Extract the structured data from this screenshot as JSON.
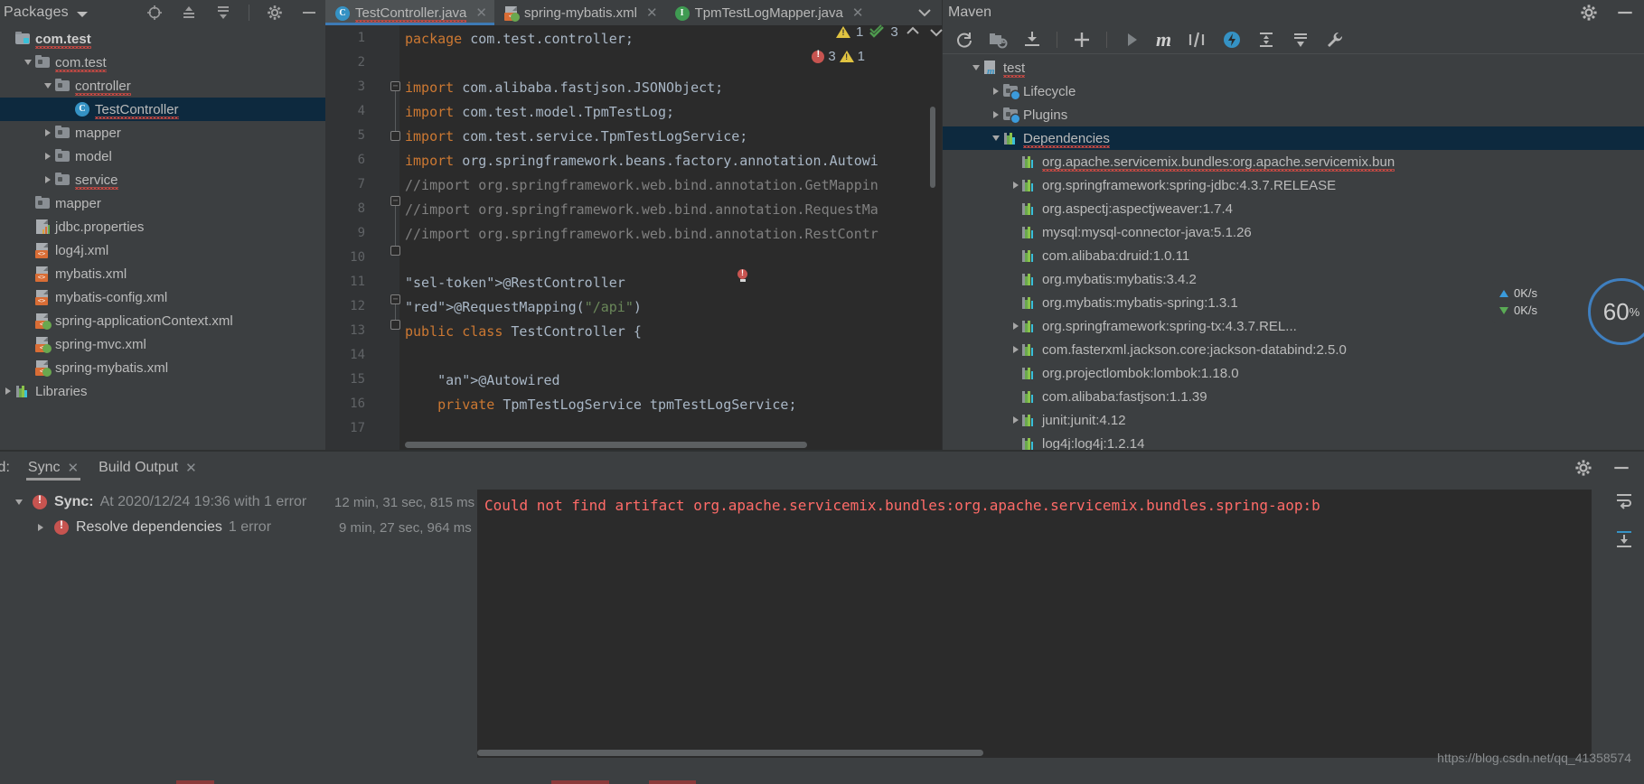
{
  "project_panel": {
    "title": "Packages",
    "toolbar_icons": [
      "locate-icon",
      "expand-all-icon",
      "collapse-all-icon",
      "settings-gear-icon",
      "hide-panel-icon"
    ],
    "tree": [
      {
        "label": "com.test",
        "icon": "package-root-icon",
        "indent": 0,
        "twisty": "none",
        "bold": true,
        "squiggle": true,
        "selected": false
      },
      {
        "label": "com.test",
        "icon": "folder-icon",
        "indent": 1,
        "twisty": "open",
        "bold": false,
        "squiggle": true,
        "selected": false
      },
      {
        "label": "controller",
        "icon": "folder-icon",
        "indent": 2,
        "twisty": "open",
        "bold": false,
        "squiggle": true,
        "selected": false
      },
      {
        "label": "TestController",
        "icon": "java-class-icon",
        "indent": 3,
        "twisty": "none",
        "bold": false,
        "squiggle": true,
        "selected": true
      },
      {
        "label": "mapper",
        "icon": "folder-icon",
        "indent": 2,
        "twisty": "closed",
        "bold": false,
        "squiggle": false,
        "selected": false
      },
      {
        "label": "model",
        "icon": "folder-icon",
        "indent": 2,
        "twisty": "closed",
        "bold": false,
        "squiggle": false,
        "selected": false
      },
      {
        "label": "service",
        "icon": "folder-icon",
        "indent": 2,
        "twisty": "closed",
        "bold": false,
        "squiggle": true,
        "selected": false
      },
      {
        "label": "mapper",
        "icon": "folder-icon",
        "indent": 1,
        "twisty": "none",
        "bold": false,
        "squiggle": false,
        "selected": false
      },
      {
        "label": "jdbc.properties",
        "icon": "properties-file-icon",
        "indent": 1,
        "twisty": "none",
        "bold": false,
        "squiggle": false,
        "selected": false
      },
      {
        "label": "log4j.xml",
        "icon": "xml-file-icon",
        "indent": 1,
        "twisty": "none",
        "bold": false,
        "squiggle": false,
        "selected": false
      },
      {
        "label": "mybatis.xml",
        "icon": "xml-file-icon",
        "indent": 1,
        "twisty": "none",
        "bold": false,
        "squiggle": false,
        "selected": false
      },
      {
        "label": "mybatis-config.xml",
        "icon": "xml-file-icon",
        "indent": 1,
        "twisty": "none",
        "bold": false,
        "squiggle": false,
        "selected": false
      },
      {
        "label": "spring-applicationContext.xml",
        "icon": "spring-xml-file-icon",
        "indent": 1,
        "twisty": "none",
        "bold": false,
        "squiggle": false,
        "selected": false
      },
      {
        "label": "spring-mvc.xml",
        "icon": "spring-xml-file-icon",
        "indent": 1,
        "twisty": "none",
        "bold": false,
        "squiggle": false,
        "selected": false
      },
      {
        "label": "spring-mybatis.xml",
        "icon": "spring-xml-file-icon",
        "indent": 1,
        "twisty": "none",
        "bold": false,
        "squiggle": false,
        "selected": false
      },
      {
        "label": "Libraries",
        "icon": "libraries-icon",
        "indent": 0,
        "twisty": "closed",
        "bold": false,
        "squiggle": false,
        "selected": false
      }
    ]
  },
  "editor": {
    "tabs": [
      {
        "label": "TestController.java",
        "icon": "java-class-icon",
        "active": true,
        "closable": true,
        "squiggle": true
      },
      {
        "label": "spring-mybatis.xml",
        "icon": "spring-xml-file-icon",
        "active": false,
        "closable": true,
        "squiggle": false
      },
      {
        "label": "TpmTestLogMapper.java",
        "icon": "java-interface-icon",
        "active": false,
        "closable": true,
        "squiggle": false
      }
    ],
    "inspections": {
      "errors": "3",
      "warnings": "1",
      "weak_warnings": "1",
      "passed": "3"
    },
    "line_numbers": [
      "1",
      "2",
      "3",
      "4",
      "5",
      "6",
      "7",
      "8",
      "9",
      "10",
      "11",
      "12",
      "13",
      "14",
      "15",
      "16",
      "17"
    ],
    "code": [
      {
        "n": 1,
        "text": "package com.test.controller;"
      },
      {
        "n": 2,
        "text": ""
      },
      {
        "n": 3,
        "text": "import com.alibaba.fastjson.JSONObject;"
      },
      {
        "n": 4,
        "text": "import com.test.model.TpmTestLog;"
      },
      {
        "n": 5,
        "text": "import com.test.service.TpmTestLogService;"
      },
      {
        "n": 6,
        "text": "import org.springframework.beans.factory.annotation.Autowi"
      },
      {
        "n": 7,
        "text": "//import org.springframework.web.bind.annotation.GetMappin"
      },
      {
        "n": 8,
        "text": "//import org.springframework.web.bind.annotation.RequestMa"
      },
      {
        "n": 9,
        "text": "//import org.springframework.web.bind.annotation.RestContr"
      },
      {
        "n": 10,
        "text": ""
      },
      {
        "n": 11,
        "text": "@RestController"
      },
      {
        "n": 12,
        "text": "@RequestMapping(\"/api\")"
      },
      {
        "n": 13,
        "text": "public class TestController {"
      },
      {
        "n": 14,
        "text": ""
      },
      {
        "n": 15,
        "text": "    @Autowired"
      },
      {
        "n": 16,
        "text": "    private TpmTestLogService tpmTestLogService;"
      },
      {
        "n": 17,
        "text": ""
      }
    ],
    "selected_token": "@RestController"
  },
  "maven": {
    "title": "Maven",
    "header_icons": [
      "settings-gear-icon",
      "hide-panel-icon"
    ],
    "toolbar_icons": [
      "reimport-icon",
      "generate-sources-icon",
      "download-sources-icon",
      "add-icon",
      "run-icon",
      "execute-maven-goal-icon",
      "toggle-skip-tests-icon",
      "toggle-offline-icon",
      "expand-all-icon",
      "collapse-all-icon",
      "settings-wrench-icon"
    ],
    "tree": [
      {
        "label": "test",
        "icon": "maven-project-icon",
        "indent": 1,
        "twisty": "open",
        "selected": false,
        "squiggle": true
      },
      {
        "label": "Lifecycle",
        "icon": "folder-gear-icon",
        "indent": 2,
        "twisty": "closed",
        "selected": false,
        "squiggle": false
      },
      {
        "label": "Plugins",
        "icon": "folder-gear-icon",
        "indent": 2,
        "twisty": "closed",
        "selected": false,
        "squiggle": false
      },
      {
        "label": "Dependencies",
        "icon": "dependencies-icon",
        "indent": 2,
        "twisty": "open",
        "selected": true,
        "squiggle": true
      },
      {
        "label": "org.apache.servicemix.bundles:org.apache.servicemix.bun",
        "icon": "dependency-icon",
        "indent": 3,
        "twisty": "none",
        "selected": false,
        "squiggle": true
      },
      {
        "label": "org.springframework:spring-jdbc:4.3.7.RELEASE",
        "icon": "dependency-icon",
        "indent": 3,
        "twisty": "closed",
        "selected": false,
        "squiggle": false
      },
      {
        "label": "org.aspectj:aspectjweaver:1.7.4",
        "icon": "dependency-icon",
        "indent": 3,
        "twisty": "none",
        "selected": false,
        "squiggle": false
      },
      {
        "label": "mysql:mysql-connector-java:5.1.26",
        "icon": "dependency-icon",
        "indent": 3,
        "twisty": "none",
        "selected": false,
        "squiggle": false
      },
      {
        "label": "com.alibaba:druid:1.0.11",
        "icon": "dependency-icon",
        "indent": 3,
        "twisty": "none",
        "selected": false,
        "squiggle": false
      },
      {
        "label": "org.mybatis:mybatis:3.4.2",
        "icon": "dependency-icon",
        "indent": 3,
        "twisty": "none",
        "selected": false,
        "squiggle": false
      },
      {
        "label": "org.mybatis:mybatis-spring:1.3.1",
        "icon": "dependency-icon",
        "indent": 3,
        "twisty": "none",
        "selected": false,
        "squiggle": false
      },
      {
        "label": "org.springframework:spring-tx:4.3.7.REL...",
        "icon": "dependency-icon",
        "indent": 3,
        "twisty": "closed",
        "selected": false,
        "squiggle": false
      },
      {
        "label": "com.fasterxml.jackson.core:jackson-databind:2.5.0",
        "icon": "dependency-icon",
        "indent": 3,
        "twisty": "closed",
        "selected": false,
        "squiggle": false
      },
      {
        "label": "org.projectlombok:lombok:1.18.0",
        "icon": "dependency-icon",
        "indent": 3,
        "twisty": "none",
        "selected": false,
        "squiggle": false
      },
      {
        "label": "com.alibaba:fastjson:1.1.39",
        "icon": "dependency-icon",
        "indent": 3,
        "twisty": "none",
        "selected": false,
        "squiggle": false
      },
      {
        "label": "junit:junit:4.12",
        "icon": "dependency-icon",
        "indent": 3,
        "twisty": "closed",
        "selected": false,
        "squiggle": false
      },
      {
        "label": "log4j:log4j:1.2.14",
        "icon": "dependency-icon",
        "indent": 3,
        "twisty": "none",
        "selected": false,
        "squiggle": false
      }
    ],
    "network": {
      "upload": "0K/s",
      "download": "0K/s"
    },
    "gauge": {
      "value": "60",
      "unit": "%"
    }
  },
  "build": {
    "panel_label": "ld:",
    "tabs": [
      {
        "label": "Sync",
        "active": true,
        "closable": true
      },
      {
        "label": "Build Output",
        "active": false,
        "closable": true
      }
    ],
    "tools": [
      "settings-gear-icon",
      "hide-panel-icon",
      "soft-wrap-icon",
      "scroll-to-end-icon"
    ],
    "rows": [
      {
        "title": "Sync:",
        "detail": "At 2020/12/24 19:36 with 1 error",
        "duration": "12 min, 31 sec, 815 ms",
        "indent": 0,
        "twisty": "open"
      },
      {
        "title": "Resolve dependencies",
        "detail": "1 error",
        "duration": "9 min, 27 sec, 964 ms",
        "indent": 1,
        "twisty": "closed"
      }
    ],
    "console_message": "Could not find artifact org.apache.servicemix.bundles:org.apache.servicemix.bundles.spring-aop:b",
    "watermark": "https://blog.csdn.net/qq_41358574"
  }
}
